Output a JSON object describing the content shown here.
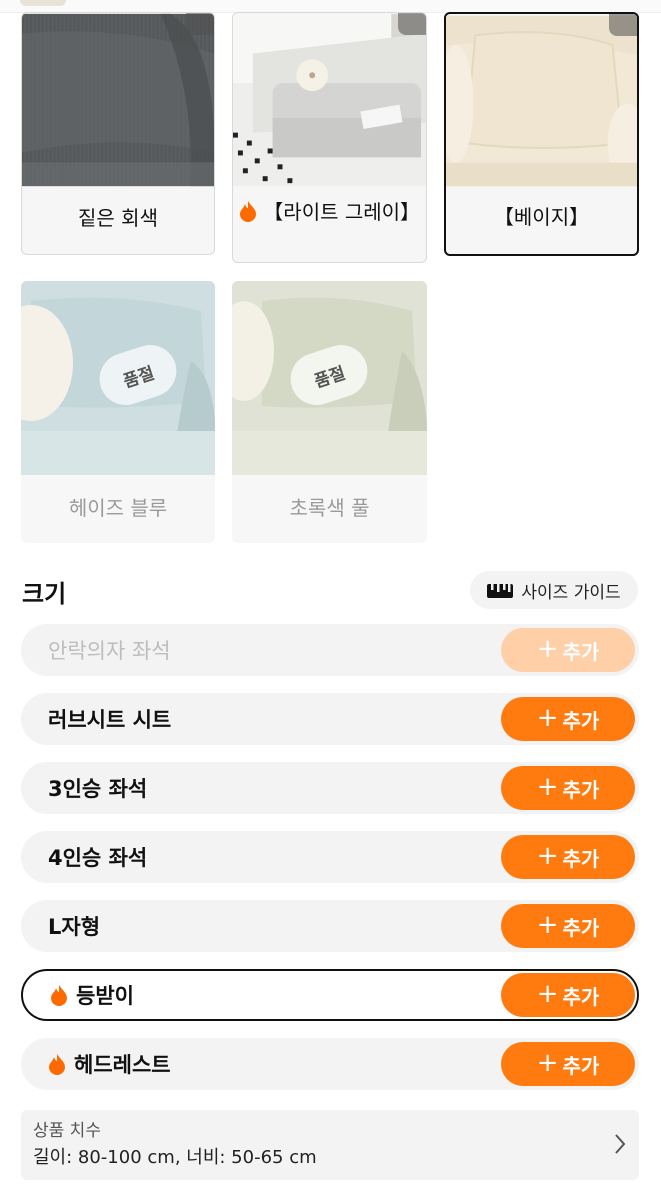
{
  "colors": {
    "accent": "#ff7a0f",
    "accent_disabled": "#ffcfa8",
    "flame": "#ff6a00"
  },
  "color_options": [
    {
      "label": "짙은 회색",
      "hot": false,
      "selected": false,
      "sold_out": false
    },
    {
      "label": "【라이트 그레이】",
      "hot": true,
      "selected": false,
      "sold_out": false
    },
    {
      "label": "【베이지】",
      "hot": false,
      "selected": true,
      "sold_out": false
    },
    {
      "label": "헤이즈 블루",
      "hot": false,
      "selected": false,
      "sold_out": true,
      "badge": "품절"
    },
    {
      "label": "초록색 풀",
      "hot": false,
      "selected": false,
      "sold_out": true,
      "badge": "품절"
    }
  ],
  "size_section": {
    "title": "크기",
    "guide_label": "사이즈 가이드",
    "guide_icon": "ruler-icon",
    "add_label": "추가",
    "options": [
      {
        "label": "안락의자 좌석",
        "disabled": true,
        "hot": false,
        "selected": false
      },
      {
        "label": "러브시트 시트",
        "disabled": false,
        "hot": false,
        "selected": false
      },
      {
        "label": "3인승 좌석",
        "disabled": false,
        "hot": false,
        "selected": false
      },
      {
        "label": "4인승 좌석",
        "disabled": false,
        "hot": false,
        "selected": false
      },
      {
        "label": "L자형",
        "disabled": false,
        "hot": false,
        "selected": false
      },
      {
        "label": "등받이",
        "disabled": false,
        "hot": true,
        "selected": true
      },
      {
        "label": "헤드레스트",
        "disabled": false,
        "hot": true,
        "selected": false
      }
    ]
  },
  "dimensions": {
    "title": "상품 치수",
    "value": "길이: 80-100 cm, 너비: 50-65 cm"
  }
}
